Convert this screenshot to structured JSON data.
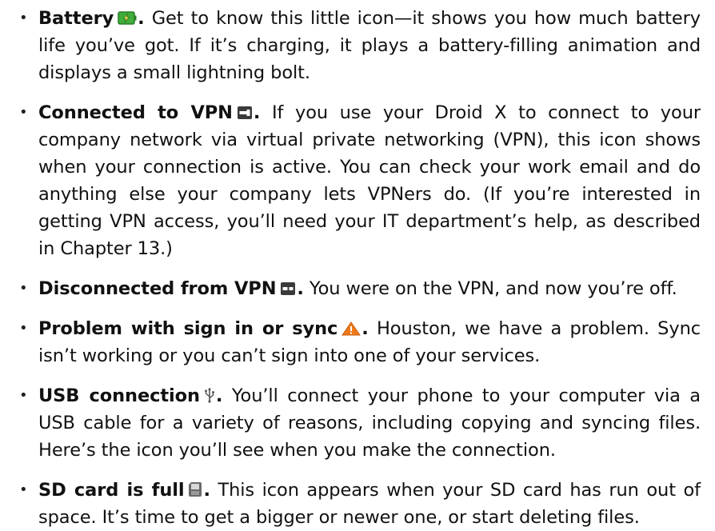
{
  "bullet": "•",
  "items": [
    {
      "term": "Battery",
      "icon": "battery-charging-icon",
      "after_icon": ".",
      "text": " Get to know this little icon—it shows you how much battery life you’ve got. If it’s charging, it plays a battery-filling animation and displays a small lightning bolt."
    },
    {
      "term": "Connected to VPN",
      "icon": "vpn-connected-icon",
      "after_icon": ".",
      "text": " If you use your Droid X to connect to your company network via virtual private networking (VPN), this icon shows when your connection is active. You can check your work email and do anything else your company lets VPNers do. (If you’re interested in getting VPN access, you’ll need your IT department’s help, as described in Chapter 13.)"
    },
    {
      "term": "Disconnected from VPN",
      "icon": "vpn-disconnected-icon",
      "after_icon": ".",
      "text": " You were on the VPN, and now you’re off."
    },
    {
      "term": "Problem with sign in or sync",
      "icon": "warning-triangle-icon",
      "after_icon": ".",
      "text": " Houston, we have a problem. Sync isn’t working or you can’t sign into one of your services."
    },
    {
      "term": "USB connection",
      "icon": "usb-icon",
      "after_icon": ".",
      "text": " You’ll connect your phone to your computer via a USB cable for a variety of reasons, including copying and syncing files. Here’s the icon you’ll see when you make the connection."
    },
    {
      "term": "SD card is full",
      "icon": "sd-card-full-icon",
      "after_icon": ".",
      "text": " This icon appears when your SD card has run out of space. It’s time to get a bigger or newer one, or start deleting files."
    }
  ],
  "colors": {
    "battery_green": "#3fae3a",
    "vpn_gray": "#3a3a3a",
    "warning_orange": "#f07a1a"
  }
}
